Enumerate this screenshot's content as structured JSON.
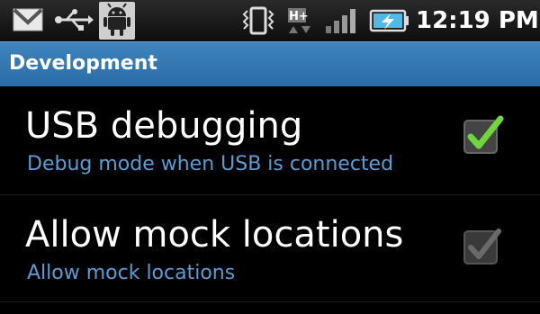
{
  "status_bar": {
    "time": "12:19 PM",
    "icons": [
      "gmail-icon",
      "usb-icon",
      "debug-android-icon",
      "vibrate-icon",
      "hplus-data-icon",
      "signal-icon",
      "battery-charging-icon"
    ],
    "hplus_label": "H+"
  },
  "section": {
    "title": "Development"
  },
  "settings": [
    {
      "title": "USB debugging",
      "summary": "Debug mode when USB is connected",
      "checked": true,
      "enabled": true
    },
    {
      "title": "Allow mock locations",
      "summary": "Allow mock locations",
      "checked": true,
      "enabled": false
    }
  ],
  "colors": {
    "header": "#3a7bb4",
    "summary_text": "#5d9bd0",
    "check_active": "#6fd63d",
    "check_disabled": "#6a6a6a"
  }
}
